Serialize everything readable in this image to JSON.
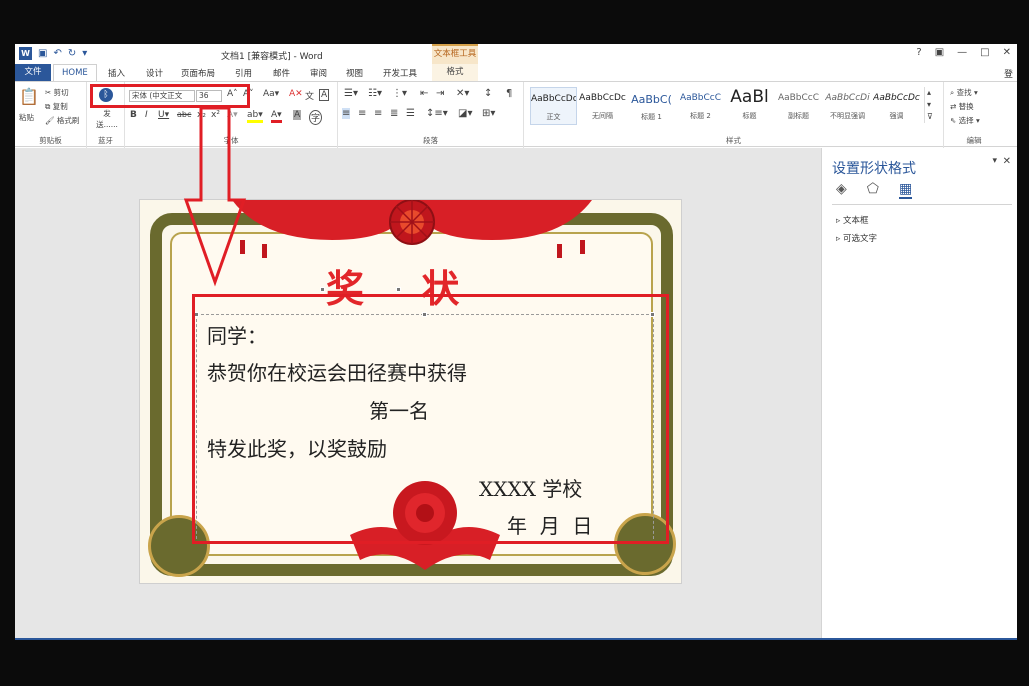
{
  "title_bar": {
    "document_title": "文档1 [兼容模式] - Word",
    "context_tab_group": "文本框工具",
    "window_buttons": [
      "?",
      "▣",
      "—",
      "□",
      "✕"
    ],
    "user": "登"
  },
  "tabs": [
    {
      "label": "文件"
    },
    {
      "label": "HOME"
    },
    {
      "label": "插入"
    },
    {
      "label": "设计"
    },
    {
      "label": "页面布局"
    },
    {
      "label": "引用"
    },
    {
      "label": "邮件"
    },
    {
      "label": "审阅"
    },
    {
      "label": "视图"
    },
    {
      "label": "开发工具"
    },
    {
      "label": "格式"
    }
  ],
  "ribbon": {
    "clipboard": {
      "paste": "粘贴",
      "cut": "剪切",
      "copy": "复制",
      "format_painter": "格式刷",
      "group": "剪贴板"
    },
    "bluetooth": {
      "send": "发送......",
      "group": "蓝牙"
    },
    "font": {
      "font_name": "宋体 (中文正文",
      "font_size": "36",
      "group": "字体"
    },
    "paragraph": {
      "group": "段落"
    },
    "styles": {
      "items": [
        {
          "preview": "AaBbCcDc",
          "name": "正文"
        },
        {
          "preview": "AaBbCcDc",
          "name": "无间隔"
        },
        {
          "preview": "AaBbC(",
          "name": "标题 1"
        },
        {
          "preview": "AaBbCcC",
          "name": "标题 2"
        },
        {
          "preview": "AaBl",
          "name": "标题"
        },
        {
          "preview": "AaBbCcC",
          "name": "副标题"
        },
        {
          "preview": "AaBbCcDi",
          "name": "不明显强调"
        },
        {
          "preview": "AaBbCcDc",
          "name": "强调"
        }
      ],
      "group": "样式"
    },
    "editing": {
      "find": "查找",
      "replace": "替换",
      "select": "选择",
      "group": "编辑"
    }
  },
  "certificate": {
    "title": "奖 状",
    "line1": "同学：",
    "line2": "恭贺你在校运会田径赛中获得",
    "line3": "第一名",
    "line4": "特发此奖，以奖鼓励",
    "school": "XXXX 学校",
    "date": "年  月  日"
  },
  "format_pane": {
    "title": "设置形状格式",
    "items": [
      "文本框",
      "可选文字"
    ]
  },
  "colors": {
    "word_blue": "#2b579a",
    "highlight_red": "#e01e25",
    "certificate_red": "#e2262a",
    "frame_olive": "#6a6a2e"
  }
}
